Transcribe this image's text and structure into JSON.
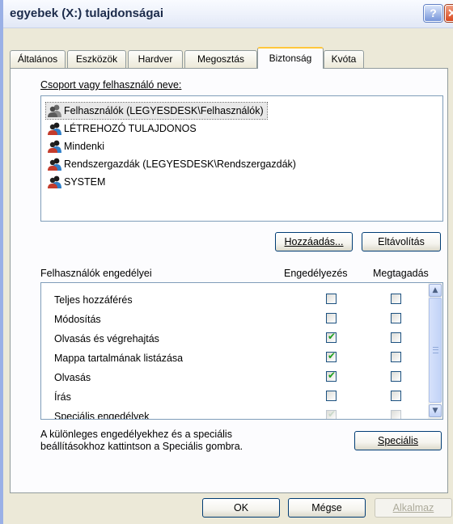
{
  "window": {
    "title": "egyebek (X:) tulajdonságai",
    "help_symbol": "?",
    "close_symbol": "✕"
  },
  "tabs": [
    {
      "label": "Általános"
    },
    {
      "label": "Eszközök"
    },
    {
      "label": "Hardver"
    },
    {
      "label": "Megosztás"
    },
    {
      "label": "Biztonság",
      "active": true
    },
    {
      "label": "Kvóta"
    }
  ],
  "users_section": {
    "label": "Csoport vagy felhasználó neve:",
    "items": [
      {
        "name": "Felhasználók (LEGYESDESK\\Felhasználók)",
        "selected": true,
        "icon": "group-icon"
      },
      {
        "name": "LÉTREHOZÓ TULAJDONOS",
        "icon": "group-icon"
      },
      {
        "name": "Mindenki",
        "icon": "group-icon"
      },
      {
        "name": "Rendszergazdák (LEGYESDESK\\Rendszergazdák)",
        "icon": "group-icon"
      },
      {
        "name": "SYSTEM",
        "icon": "group-icon"
      }
    ],
    "add_button": "Hozzáadás...",
    "remove_button": "Eltávolítás"
  },
  "permissions": {
    "header_label": "Felhasználók engedélyei",
    "allow_header": "Engedélyezés",
    "deny_header": "Megtagadás",
    "rows": [
      {
        "label": "Teljes hozzáférés",
        "allow": false,
        "deny": false
      },
      {
        "label": "Módosítás",
        "allow": false,
        "deny": false
      },
      {
        "label": "Olvasás és végrehajtás",
        "allow": true,
        "deny": false
      },
      {
        "label": "Mappa tartalmának listázása",
        "allow": true,
        "deny": false
      },
      {
        "label": "Olvasás",
        "allow": true,
        "deny": false
      },
      {
        "label": "Írás",
        "allow": false,
        "deny": false
      },
      {
        "label": "Speciális engedélyek",
        "allow": true,
        "deny": false
      }
    ]
  },
  "advanced": {
    "note_line1": "A különleges engedélyekhez és a speciális",
    "note_line2": "beállításokhoz kattintson a Speciális gombra.",
    "button": "Speciális"
  },
  "footer": {
    "ok": "OK",
    "cancel": "Mégse",
    "apply": "Alkalmaz"
  },
  "colors": {
    "dialog_bg": "#ece9d8",
    "tab_highlight": "#ffc73c",
    "check": "#21a121",
    "border_blue": "#7f9db9"
  }
}
